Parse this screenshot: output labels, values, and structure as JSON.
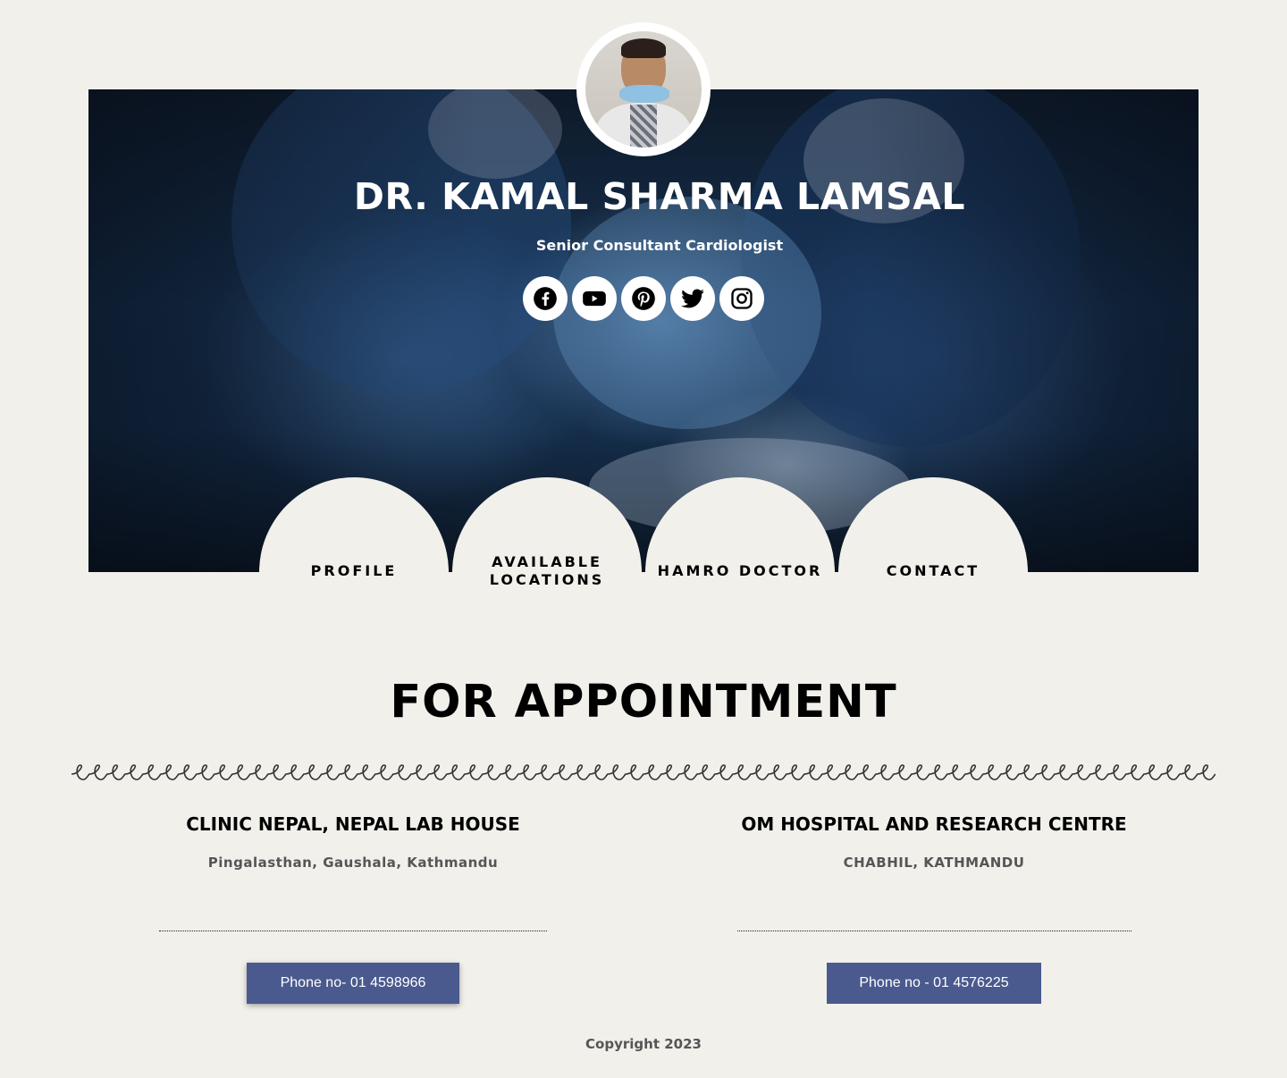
{
  "hero": {
    "name": "DR. KAMAL SHARMA LAMSAL",
    "subtitle": "Senior Consultant Cardiologist",
    "social": [
      "facebook-icon",
      "youtube-icon",
      "pinterest-icon",
      "twitter-icon",
      "instagram-icon"
    ]
  },
  "nav": {
    "items": [
      {
        "label": "PROFILE"
      },
      {
        "label": "AVAILABLE LOCATIONS"
      },
      {
        "label": "HAMRO DOCTOR"
      },
      {
        "label": "CONTACT"
      }
    ]
  },
  "appointment": {
    "title": "FOR APPOINTMENT",
    "locations": [
      {
        "name": "CLINIC NEPAL, NEPAL LAB HOUSE",
        "address": "Pingalasthan, Gaushala, Kathmandu",
        "phone": "Phone no- 01 4598966"
      },
      {
        "name": "OM HOSPITAL AND RESEARCH CENTRE",
        "address": "CHABHIL, KATHMANDU",
        "phone": "Phone no - 01 4576225"
      }
    ]
  },
  "footer": {
    "copyright": "Copyright 2023"
  },
  "colors": {
    "background": "#f1f0eb",
    "button": "#4a5a8e",
    "muted_text": "#555555"
  }
}
